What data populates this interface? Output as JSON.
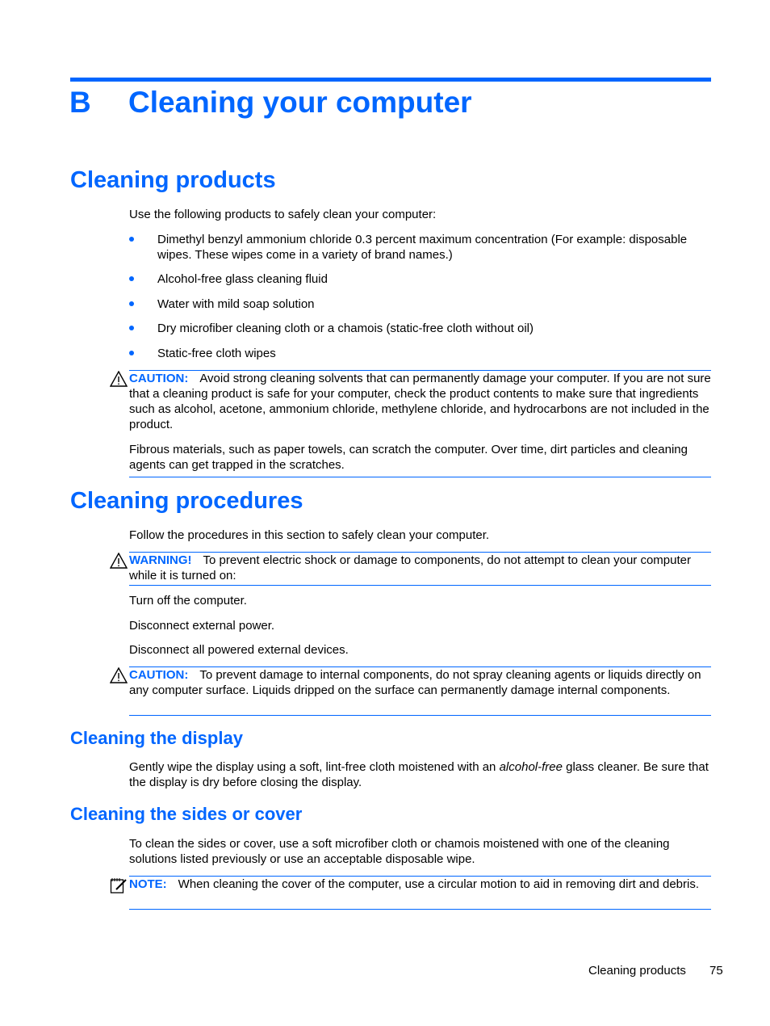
{
  "chapter": {
    "letter": "B",
    "title": "Cleaning your computer"
  },
  "sections": {
    "products": {
      "title": "Cleaning products",
      "intro": "Use the following products to safely clean your computer:",
      "items": [
        "Dimethyl benzyl ammonium chloride 0.3 percent maximum concentration (For example: disposable wipes. These wipes come in a variety of brand names.)",
        "Alcohol-free glass cleaning fluid",
        "Water with mild soap solution",
        "Dry microfiber cleaning cloth or a chamois (static-free cloth without oil)",
        "Static-free cloth wipes"
      ],
      "caution": {
        "label": "CAUTION:",
        "text": "Avoid strong cleaning solvents that can permanently damage your computer. If you are not sure that a cleaning product is safe for your computer, check the product contents to make sure that ingredients such as alcohol, acetone, ammonium chloride, methylene chloride, and hydrocarbons are not included in the product.",
        "followup": "Fibrous materials, such as paper towels, can scratch the computer. Over time, dirt particles and cleaning agents can get trapped in the scratches."
      }
    },
    "procedures": {
      "title": "Cleaning procedures",
      "intro": "Follow the procedures in this section to safely clean your computer.",
      "warning": {
        "label": "WARNING!",
        "text": "To prevent electric shock or damage to components, do not attempt to clean your computer while it is turned on:"
      },
      "steps": [
        "Turn off the computer.",
        "Disconnect external power.",
        "Disconnect all powered external devices."
      ],
      "caution": {
        "label": "CAUTION:",
        "text": "To prevent damage to internal components, do not spray cleaning agents or liquids directly on any computer surface. Liquids dripped on the surface can permanently damage internal components."
      }
    },
    "display": {
      "title": "Cleaning the display",
      "text_before": "Gently wipe the display using a soft, lint-free cloth moistened with an ",
      "text_italic": "alcohol-free",
      "text_after": " glass cleaner. Be sure that the display is dry before closing the display."
    },
    "sides": {
      "title": "Cleaning the sides or cover",
      "text": "To clean the sides or cover, use a soft microfiber cloth or chamois moistened with one of the cleaning solutions listed previously or use an acceptable disposable wipe.",
      "note": {
        "label": "NOTE:",
        "text": "When cleaning the cover of the computer, use a circular motion to aid in removing dirt and debris."
      }
    }
  },
  "footer": {
    "section": "Cleaning products",
    "page": "75"
  },
  "colors": {
    "accent": "#0066ff"
  }
}
